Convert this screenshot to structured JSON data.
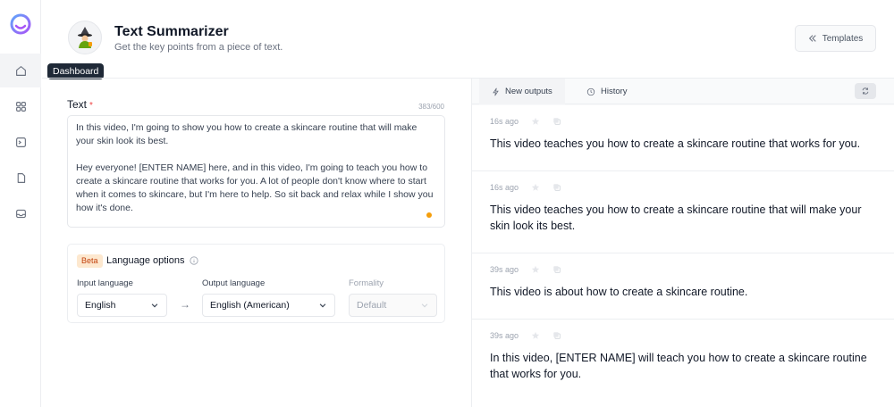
{
  "rail": {
    "tooltip": "Dashboard",
    "items": [
      "home-icon",
      "grid-icon",
      "terminal-icon",
      "document-icon",
      "inbox-icon"
    ]
  },
  "header": {
    "title": "Text Summarizer",
    "subtitle": "Get the key points from a piece of text.",
    "templates_label": "Templates"
  },
  "form": {
    "text_label": "Text",
    "required_mark": "*",
    "char_count": "383/600",
    "text_paragraphs": [
      "In this video, I'm going to show you how to create a skincare routine that will make your skin look its best.",
      "Hey everyone! [ENTER NAME] here, and in this video, I'm going to teach you how to create a skincare routine that works for you. A lot of people don't know where to start when it comes to skincare, but I'm here to help. So sit back and relax while I show you how it's done."
    ],
    "language": {
      "badge": "Beta",
      "title": "Language options",
      "input_label": "Input language",
      "input_value": "English",
      "arrow": "→",
      "output_label": "Output language",
      "output_value": "English (American)",
      "formality_label": "Formality",
      "formality_value": "Default"
    }
  },
  "outputs_panel": {
    "tabs": [
      {
        "label": "New outputs",
        "icon": "bolt-icon"
      },
      {
        "label": "History",
        "icon": "clock-icon"
      }
    ],
    "items": [
      {
        "time": "16s ago",
        "text": "This video teaches you how to create a skincare routine that works for you."
      },
      {
        "time": "16s ago",
        "text": "This video teaches you how to create a skincare routine that will make your skin look its best."
      },
      {
        "time": "39s ago",
        "text": "This video is about how to create a skincare routine."
      },
      {
        "time": "39s ago",
        "text": "In this video, [ENTER NAME] will teach you how to create a skincare routine that works for you."
      }
    ]
  },
  "colors": {
    "accent_purple": "#8b5cf6",
    "beta_bg": "#fde8cf",
    "beta_text": "#c2410c",
    "status_dot": "#f59e0b"
  }
}
